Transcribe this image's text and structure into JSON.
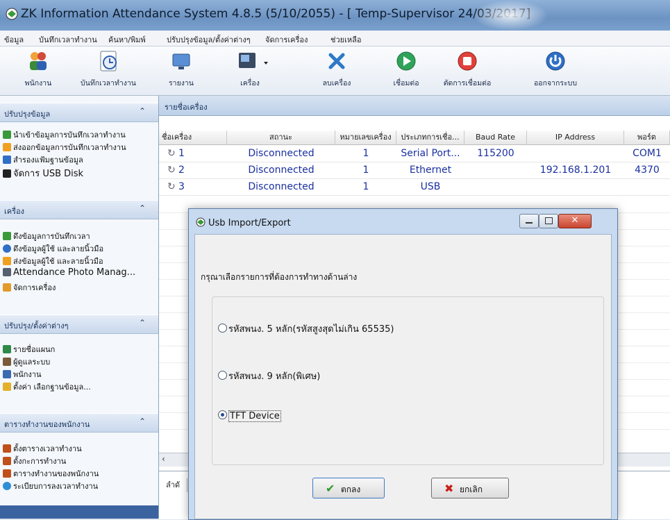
{
  "window": {
    "title": "ZK Information Attendance System 4.8.5 (5/10/2055) - [ Temp-Supervisor 24/03/2017]"
  },
  "menu": [
    "ข้อมูล",
    "บันทึกเวลาทำงาน",
    "ค้นหา/พิมพ์",
    "ปรับปรุงข้อมูล/ตั้งค่าต่างๆ",
    "จัดการเครื่อง",
    "ช่วยเหลือ"
  ],
  "toolbar": {
    "employees": "พนักงาน",
    "time_records": "บันทึกเวลาทำงาน",
    "reports": "รายงาน",
    "devices": "เครื่อง",
    "delete_device": "ลบเครื่อง",
    "connect": "เชื่อมต่อ",
    "disconnect": "ตัดการเชื่อมต่อ",
    "exit": "ออกจากระบบ"
  },
  "sidebar": {
    "sections": [
      {
        "title": "ปรับปรุงข้อมูล",
        "items": [
          "นำเข้าข้อมูลการบันทึกเวลาทำงาน",
          "ส่งออกข้อมูลการบันทึกเวลาทำงาน",
          "สำรองแฟ้มฐานข้อมูล",
          "จัดการ USB Disk"
        ]
      },
      {
        "title": "เครื่อง",
        "items": [
          "ดึงข้อมูลการบันทึกเวลา",
          "ดึงข้อมูลผู้ใช้ และลายนิ้วมือ",
          "ส่งข้อมูลผู้ใช้ และลายนิ้วมือ",
          "Attendance Photo Manag...",
          "จัดการเครื่อง"
        ]
      },
      {
        "title": "ปรับปรุง/ตั้งค่าต่างๆ",
        "items": [
          "รายชื่อแผนก",
          "ผู้ดูแลระบบ",
          "พนักงาน",
          "ตั้งค่า เลือกฐานข้อมูล..."
        ]
      },
      {
        "title": "ตารางทำงานของพนักงาน",
        "items": [
          "ตั้งตารางเวลาทำงาน",
          "ตั้งกะการทำงาน",
          "ตารางทำงานของพนักงาน",
          "ระเบียบการลงเวลาทำงาน"
        ]
      }
    ]
  },
  "device_list": {
    "header": "รายชื่อเครื่อง",
    "columns": [
      "ชื่อเครื่อง",
      "สถานะ",
      "หมายเลขเครื่อง",
      "ประเภทการเชื่อ...",
      "Baud Rate",
      "IP Address",
      "พอร์ต"
    ],
    "rows": [
      {
        "name": "1",
        "status": "Disconnected",
        "number": "1",
        "type": "Serial Port...",
        "baud": "115200",
        "ip": "",
        "port": "COM1"
      },
      {
        "name": "2",
        "status": "Disconnected",
        "number": "1",
        "type": "Ethernet",
        "baud": "",
        "ip": "192.168.1.201",
        "port": "4370"
      },
      {
        "name": "3",
        "status": "Disconnected",
        "number": "1",
        "type": "USB",
        "baud": "",
        "ip": "",
        "port": ""
      }
    ],
    "lower_col": "ลำดั"
  },
  "dialog": {
    "title": "Usb Import/Export",
    "prompt": "กรุณาเลือกรายการที่ต้องการทำทางด้านล่าง",
    "options": [
      "รหัสพนง. 5 หลัก(รหัสสูงสุดไม่เกิน 65535)",
      "รหัสพนง. 9 หลัก(พิเศษ)",
      "TFT Device"
    ],
    "selected_option": "TFT Device",
    "ok_label": "ตกลง",
    "cancel_label": "ยกเลิก"
  },
  "colors": {
    "accent": "#3b63a0",
    "link": "#1a2fa0"
  }
}
